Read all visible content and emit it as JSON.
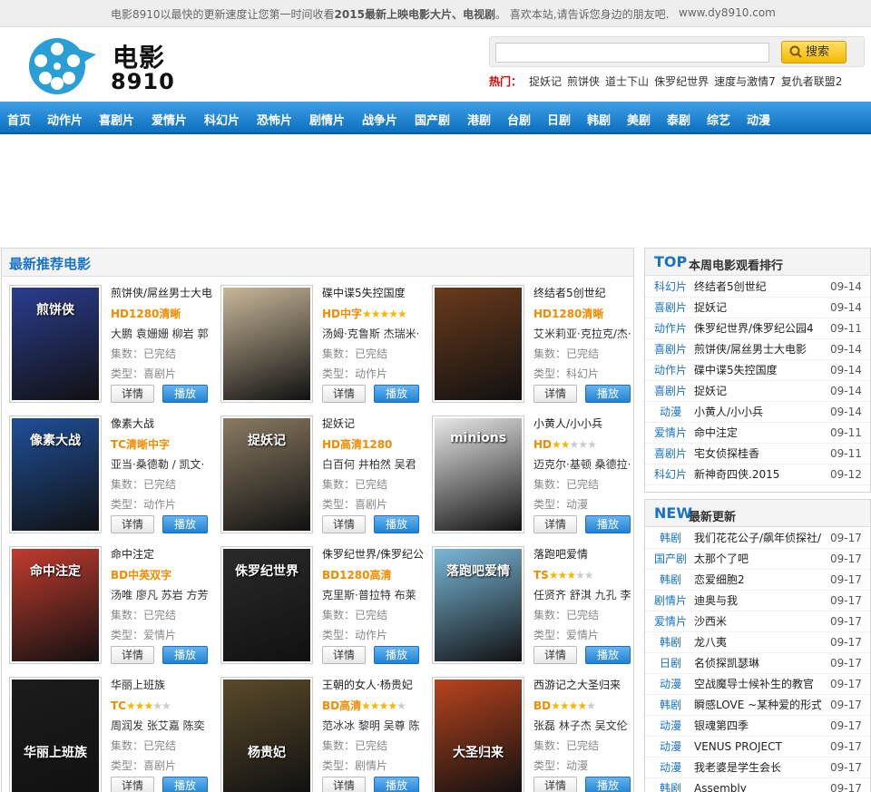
{
  "topbar": {
    "message_prefix": "电影8910以最快的更新速度让您第一时间收看",
    "message_bold": "2015最新上映电影大片、电视剧",
    "message_suffix": "。 喜欢本站,请告诉您身边的朋友吧.",
    "domain": "www.dy8910.com"
  },
  "logo": {
    "line1": "电影",
    "line2": "8910"
  },
  "search": {
    "placeholder": "",
    "button_label": "搜索"
  },
  "hot": {
    "label": "热门：",
    "keywords": [
      "捉妖记",
      "煎饼侠",
      "道士下山",
      "侏罗纪世界",
      "速度与激情7",
      "复仇者联盟2"
    ]
  },
  "nav": {
    "items": [
      "首页",
      "动作片",
      "喜剧片",
      "爱情片",
      "科幻片",
      "恐怖片",
      "剧情片",
      "战争片",
      "国产剧",
      "港剧",
      "台剧",
      "日剧",
      "韩剧",
      "美剧",
      "泰剧",
      "综艺",
      "动漫"
    ]
  },
  "colors": {
    "accent": "#1a73c8",
    "nav": "#1e82d6",
    "quality": "#f08c00",
    "hot_label": "#dd0000"
  },
  "recommend": {
    "title": "最新推荐电影",
    "detail_label": "详情",
    "play_label": "播放",
    "movies": [
      {
        "name": "煎饼侠/屌丝男士大电",
        "quality": "HD1280清晰",
        "rating": null,
        "cast": "大鹏 袁姗姗 柳岩 郭",
        "episodes": "集数：已完结",
        "genre": "类型：喜剧片",
        "poster_text": "煎饼侠",
        "poster_color": "#2b3d8f"
      },
      {
        "name": "碟中谍5失控国度",
        "quality": "HD中字",
        "rating": 5,
        "cast": "汤姆·克鲁斯 杰瑞米·",
        "episodes": "集数：已完结",
        "genre": "类型：动作片",
        "poster_text": "",
        "poster_color": "#c9b79a"
      },
      {
        "name": "终结者5创世纪",
        "quality": "HD1280清晰",
        "rating": null,
        "cast": "艾米莉亚·克拉克/杰·",
        "episodes": "集数：已完结",
        "genre": "类型：科幻片",
        "poster_text": "",
        "poster_color": "#6a3a1c"
      },
      {
        "name": "像素大战",
        "quality": "TC清晰中字",
        "rating": null,
        "cast": "亚当·桑德勒 / 凯文·",
        "episodes": "集数：已完结",
        "genre": "类型：动作片",
        "poster_text": "像素大战",
        "poster_color": "#1f4f9a"
      },
      {
        "name": "捉妖记",
        "quality": "HD高清1280",
        "rating": null,
        "cast": "白百何 井柏然 吴君",
        "episodes": "集数：已完结",
        "genre": "类型：喜剧片",
        "poster_text": "捉妖记",
        "poster_color": "#8a7a62"
      },
      {
        "name": "小黄人/小小兵",
        "quality": "HD",
        "rating": 2,
        "cast": "迈克尔·基顿 桑德拉·",
        "episodes": "集数：已完结",
        "genre": "类型：动漫",
        "poster_text": "minions",
        "poster_color": "#e8e8e8"
      },
      {
        "name": "命中注定",
        "quality": "BD中英双字",
        "rating": null,
        "cast": "汤唯 廖凡 苏岩 方芳",
        "episodes": "集数：已完结",
        "genre": "类型：爱情片",
        "poster_text": "命中注定",
        "poster_color": "#c23b2e"
      },
      {
        "name": "侏罗纪世界/侏罗纪公",
        "quality": "BD1280高清",
        "rating": null,
        "cast": "克里斯·普拉特 布莱",
        "episodes": "集数：已完结",
        "genre": "类型：动作片",
        "poster_text": "侏罗纪世界",
        "poster_color": "#2a2a2a"
      },
      {
        "name": "落跑吧爱情",
        "quality": "TS",
        "rating": 3,
        "cast": "任贤齐 舒淇 九孔 李",
        "episodes": "集数：已完结",
        "genre": "类型：爱情片",
        "poster_text": "落跑吧爱情",
        "poster_color": "#79b7d8"
      },
      {
        "name": "华丽上班族",
        "quality": "TC",
        "rating": 3,
        "cast": "周润发 张艾嘉 陈奕",
        "episodes": "集数：已完结",
        "genre": "类型：喜剧片",
        "poster_text": "华丽上班族",
        "poster_color": "#1c1c1c"
      },
      {
        "name": "王朝的女人·杨贵妃",
        "quality": "BD高清",
        "rating": 4,
        "cast": "范冰冰 黎明 吴尊 陈",
        "episodes": "集数：已完结",
        "genre": "类型：剧情片",
        "poster_text": "杨贵妃",
        "poster_color": "#5a4a2a"
      },
      {
        "name": "西游记之大圣归来",
        "quality": "BD",
        "rating": 4,
        "cast": "张磊 林子杰 吴文伦",
        "episodes": "集数：已完结",
        "genre": "类型：动漫",
        "poster_text": "大圣归来",
        "poster_color": "#b8431e"
      }
    ]
  },
  "top": {
    "big": "TOP",
    "small": "本周电影观看排行",
    "rows": [
      {
        "cat": "科幻片",
        "title": "终结者5创世纪",
        "date": "09-14"
      },
      {
        "cat": "喜剧片",
        "title": "捉妖记",
        "date": "09-14"
      },
      {
        "cat": "动作片",
        "title": "侏罗纪世界/侏罗纪公园4",
        "date": "09-11"
      },
      {
        "cat": "喜剧片",
        "title": "煎饼侠/屌丝男士大电影",
        "date": "09-14"
      },
      {
        "cat": "动作片",
        "title": "碟中谍5失控国度",
        "date": "09-14"
      },
      {
        "cat": "喜剧片",
        "title": "捉妖记",
        "date": "09-14"
      },
      {
        "cat": "动漫",
        "title": "小黄人/小小兵",
        "date": "09-14"
      },
      {
        "cat": "爱情片",
        "title": "命中注定",
        "date": "09-11"
      },
      {
        "cat": "喜剧片",
        "title": "宅女侦探桂香",
        "date": "09-11"
      },
      {
        "cat": "科幻片",
        "title": "新神奇四侠.2015",
        "date": "09-12"
      }
    ]
  },
  "latest": {
    "big": "NEW",
    "small": "最新更新",
    "rows": [
      {
        "cat": "韩剧",
        "title": "我们花花公子/飙年侦探社/",
        "date": "09-17"
      },
      {
        "cat": "国产剧",
        "title": "太那个了吧",
        "date": "09-17"
      },
      {
        "cat": "韩剧",
        "title": "恋爱细胞2",
        "date": "09-17"
      },
      {
        "cat": "剧情片",
        "title": "迪奥与我",
        "date": "09-17"
      },
      {
        "cat": "爱情片",
        "title": "沙西米",
        "date": "09-17"
      },
      {
        "cat": "韩剧",
        "title": "龙八夷",
        "date": "09-17"
      },
      {
        "cat": "日剧",
        "title": "名侦探凯瑟琳",
        "date": "09-17"
      },
      {
        "cat": "动漫",
        "title": "空战魔导士候补生的教官",
        "date": "09-17"
      },
      {
        "cat": "韩剧",
        "title": "瞬感LOVE ~某种爱的形式",
        "date": "09-17"
      },
      {
        "cat": "动漫",
        "title": "银魂第四季",
        "date": "09-17"
      },
      {
        "cat": "动漫",
        "title": "VENUS PROJECT",
        "date": "09-17"
      },
      {
        "cat": "动漫",
        "title": "我老婆是学生会长",
        "date": "09-17"
      },
      {
        "cat": "韩剧",
        "title": "Assembly",
        "date": "09-17"
      }
    ]
  }
}
